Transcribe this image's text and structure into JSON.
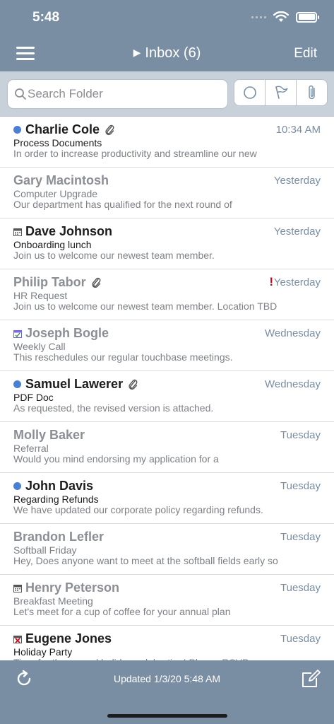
{
  "status": {
    "time": "5:48"
  },
  "nav": {
    "title": "Inbox (6)",
    "edit_label": "Edit"
  },
  "search": {
    "placeholder": "Search Folder"
  },
  "messages": [
    {
      "sender": "Charlie Cole",
      "subject": "Process Documents",
      "preview": "In order to increase productivity and streamline our new",
      "date": "10:34 AM",
      "unread": true,
      "attachment": true,
      "type": "mail"
    },
    {
      "sender": "Gary Macintosh",
      "subject": "Computer Upgrade",
      "preview": "Our department has qualified for the next round of",
      "date": "Yesterday",
      "unread": false,
      "attachment": false,
      "type": "mail"
    },
    {
      "sender": "Dave Johnson",
      "subject": "Onboarding lunch",
      "preview": "Join us to welcome our newest team member.",
      "date": "Yesterday",
      "unread": true,
      "attachment": false,
      "type": "calendar"
    },
    {
      "sender": "Philip Tabor",
      "subject": "HR Request",
      "preview": "Join us to welcome our newest team member. Location TBD",
      "date": "Yesterday",
      "unread": false,
      "attachment": true,
      "type": "mail",
      "flag": "!"
    },
    {
      "sender": "Joseph Bogle",
      "subject": "Weekly Call",
      "preview": "This reschedules our regular touchbase meetings.",
      "date": "Wednesday",
      "unread": false,
      "attachment": false,
      "type": "meeting-update"
    },
    {
      "sender": "Samuel Lawerer",
      "subject": "PDF Doc",
      "preview": "As requested, the revised version is attached.",
      "date": "Wednesday",
      "unread": true,
      "attachment": true,
      "type": "mail"
    },
    {
      "sender": "Molly Baker",
      "subject": "Referral",
      "preview": "Would you mind endorsing my application for a",
      "date": "Tuesday",
      "unread": false,
      "attachment": false,
      "type": "mail"
    },
    {
      "sender": "John Davis",
      "subject": "Regarding Refunds",
      "preview": "We have updated our corporate policy regarding refunds.",
      "date": "Tuesday",
      "unread": true,
      "attachment": false,
      "type": "mail"
    },
    {
      "sender": "Brandon Lefler",
      "subject": "Softball Friday",
      "preview": "Hey, Does anyone want to meet at the softball fields early so",
      "date": "Tuesday",
      "unread": false,
      "attachment": false,
      "type": "mail"
    },
    {
      "sender": "Henry Peterson",
      "subject": "Breakfast Meeting",
      "preview": "Let's meet for a cup of coffee for your annual plan",
      "date": "Tuesday",
      "unread": false,
      "attachment": false,
      "type": "calendar"
    },
    {
      "sender": "Eugene Jones",
      "subject": "Holiday Party",
      "preview": "Time for the annual holiday celebration! Please RSVP",
      "date": "Tuesday",
      "unread": true,
      "attachment": false,
      "type": "meeting-cancel"
    }
  ],
  "footer": {
    "updated": "Updated 1/3/20 5:48 AM"
  },
  "colors": {
    "bar": "#7a8ea3",
    "unread_dot": "#4a7fd6",
    "flag": "#d0021b",
    "searchbar": "#c8d0d9"
  }
}
